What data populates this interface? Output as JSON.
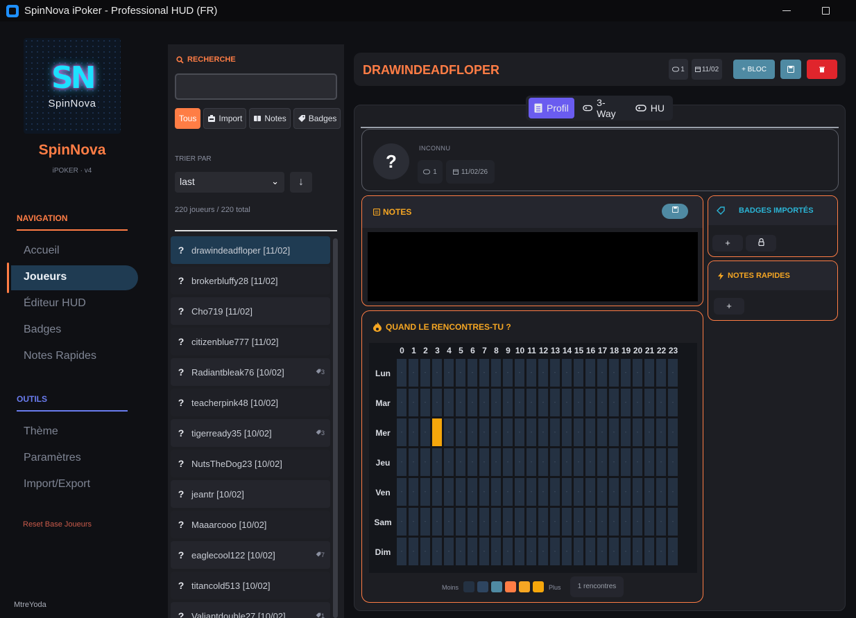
{
  "window": {
    "title": "SpinNova iPoker - Professional HUD (FR)"
  },
  "brand": {
    "logo_word": "SpinNova",
    "name": "SpinNova",
    "sub": "iPOKER · v4"
  },
  "nav": {
    "section_navigation": "NAVIGATION",
    "items": [
      "Accueil",
      "Joueurs",
      "Éditeur HUD",
      "Badges",
      "Notes Rapides"
    ],
    "section_outils": "OUTILS",
    "tools": [
      "Thème",
      "Paramètres",
      "Import/Export"
    ],
    "reset": "Reset Base Joueurs",
    "user": "MtreYoda"
  },
  "list": {
    "search_title": "RECHERCHE",
    "search_value": "",
    "filters": [
      "Tous",
      "Import",
      "Notes",
      "Badges"
    ],
    "sort_label": "TRIER PAR",
    "sort_value": "last",
    "count": "220 joueurs / 220 total",
    "rows": [
      {
        "name": "drawindeadfloper [11/02]",
        "badge": ""
      },
      {
        "name": "brokerbluffy28 [11/02]",
        "badge": ""
      },
      {
        "name": "Cho719 [11/02]",
        "badge": ""
      },
      {
        "name": "citizenblue777 [11/02]",
        "badge": ""
      },
      {
        "name": "Radiantbleak76 [10/02]",
        "badge": "3"
      },
      {
        "name": "teacherpink48 [10/02]",
        "badge": ""
      },
      {
        "name": "tigerready35 [10/02]",
        "badge": "3"
      },
      {
        "name": "NutsTheDog23 [10/02]",
        "badge": ""
      },
      {
        "name": "jeantr [10/02]",
        "badge": ""
      },
      {
        "name": "Maaarcooo [10/02]",
        "badge": ""
      },
      {
        "name": "eaglecool122 [10/02]",
        "badge": "7"
      },
      {
        "name": "titancold513 [10/02]",
        "badge": ""
      },
      {
        "name": "Valiantdouble27 [10/02]",
        "badge": "1"
      }
    ]
  },
  "header": {
    "player": "DRAWINDEADFLOPER",
    "sessions": "1",
    "date": "11/02",
    "bloc_label": "+ BLOC"
  },
  "tabs": [
    "Profil",
    "3-Way",
    "HU"
  ],
  "profile": {
    "status": "INCONNU",
    "sessions": "1",
    "date": "11/02/26"
  },
  "notes": {
    "title": "NOTES"
  },
  "badges": {
    "title": "BADGES IMPORTÉS",
    "add": "+"
  },
  "quick_notes": {
    "title": "NOTES RAPIDES",
    "add": "+"
  },
  "heatmap": {
    "title": "QUAND LE RENCONTRES-TU ?",
    "hours": [
      "0",
      "1",
      "2",
      "3",
      "4",
      "5",
      "6",
      "7",
      "8",
      "9",
      "10",
      "11",
      "12",
      "13",
      "14",
      "15",
      "16",
      "17",
      "18",
      "19",
      "20",
      "21",
      "22",
      "23"
    ],
    "days": [
      "Lun",
      "Mar",
      "Mer",
      "Jeu",
      "Ven",
      "Sam",
      "Dim"
    ],
    "empty_mark": "-",
    "hot": [
      {
        "day": 2,
        "hour": 3,
        "count": 1
      }
    ],
    "legend_less": "Moins",
    "legend_more": "Plus",
    "legend_colors": [
      "#243142",
      "#2e4560",
      "#4f8aa3",
      "#ff7d45",
      "#f5a623",
      "#f5a60b"
    ],
    "encounters": "1 rencontres"
  },
  "colors": {
    "accent": "#ff7d45",
    "tab_active": "#6a5cf0",
    "danger": "#e0252c",
    "secondary": "#4f8aa3"
  }
}
